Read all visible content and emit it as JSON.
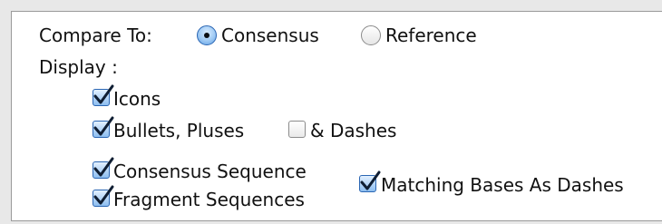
{
  "compare": {
    "label": "Compare To:",
    "options": [
      {
        "label": "Consensus",
        "selected": true
      },
      {
        "label": "Reference",
        "selected": false
      }
    ]
  },
  "display": {
    "label": "Display :",
    "icons": {
      "label": "Icons",
      "checked": true
    },
    "bullets": {
      "label": "Bullets, Pluses",
      "checked": true
    },
    "dashes": {
      "label": "& Dashes",
      "checked": false
    },
    "consensus_seq": {
      "label": "Consensus Sequence",
      "checked": true
    },
    "fragment_seq": {
      "label": "Fragment Sequences",
      "checked": true
    },
    "matching_bases": {
      "label": "Matching Bases As Dashes",
      "checked": true
    }
  },
  "colors": {
    "accent": "#2b66b3",
    "checkmark": "#0f1e33",
    "panel": "#ffffff",
    "background": "#e8e8e8"
  }
}
